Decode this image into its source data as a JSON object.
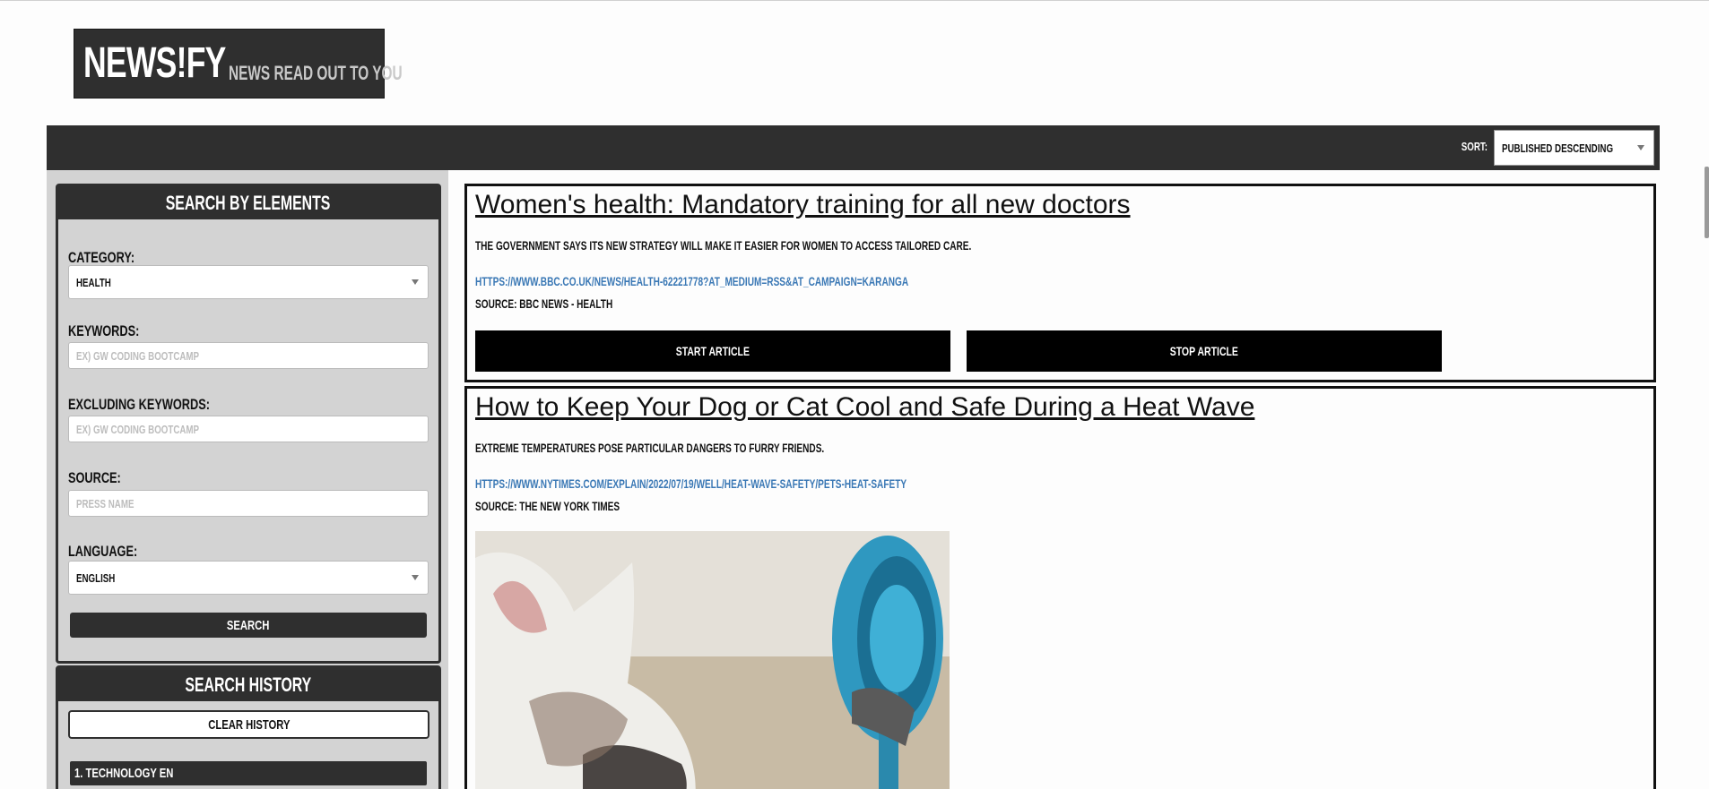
{
  "header": {
    "logo_title": "NEWS!FY",
    "logo_tagline": "NEWS READ OUT TO YOU"
  },
  "toolbar": {
    "sort_label": "SORT:",
    "sort_value": "PUBLISHED DESCENDING"
  },
  "search_panel": {
    "heading": "SEARCH BY ELEMENTS",
    "category_label": "CATEGORY:",
    "category_value": "HEALTH",
    "keywords_label": "KEYWORDS:",
    "keywords_placeholder": "EX) GW CODING BOOTCAMP",
    "excluding_label": "EXCLUDING KEYWORDS:",
    "excluding_placeholder": "EX) GW CODING BOOTCAMP",
    "source_label": "SOURCE:",
    "source_placeholder": "PRESS NAME",
    "language_label": "LANGUAGE:",
    "language_value": "ENGLISH",
    "search_button": "SEARCH"
  },
  "history_panel": {
    "heading": "SEARCH HISTORY",
    "clear_button": "CLEAR HISTORY",
    "items": [
      "1. TECHNOLOGY EN"
    ]
  },
  "articles": [
    {
      "title": "Women's health: Mandatory training for all new doctors",
      "description": "THE GOVERNMENT SAYS ITS NEW STRATEGY WILL MAKE IT EASIER FOR WOMEN TO ACCESS TAILORED CARE.",
      "url": "HTTPS://WWW.BBC.CO.UK/NEWS/HEALTH-62221778?AT_MEDIUM=RSS&AT_CAMPAIGN=KARANGA",
      "source": "SOURCE: BBC NEWS - HEALTH",
      "start_label": "START ARTICLE",
      "stop_label": "STOP ARTICLE"
    },
    {
      "title": "How to Keep Your Dog or Cat Cool and Safe During a Heat Wave",
      "description": "EXTREME TEMPERATURES POSE PARTICULAR DANGERS TO FURRY FRIENDS.",
      "url": "HTTPS://WWW.NYTIMES.COM/EXPLAIN/2022/07/19/WELL/HEAT-WAVE-SAFETY/PETS-HEAT-SAFETY",
      "source": "SOURCE: THE NEW YORK TIMES"
    }
  ],
  "colors": {
    "dark": "#2f2f2f",
    "sidebar_bg": "#d3d3d3",
    "link": "#3a78b5",
    "button_bg": "#000000"
  }
}
